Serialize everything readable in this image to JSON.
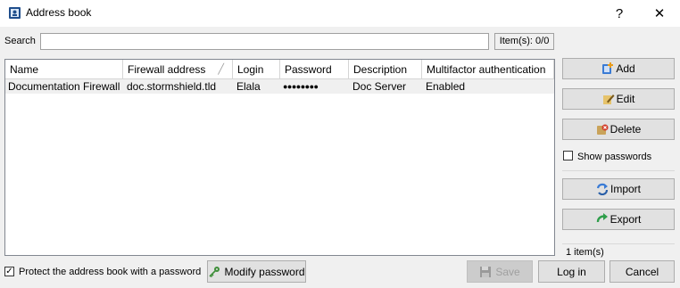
{
  "window": {
    "title": "Address book",
    "help_glyph": "?",
    "close_glyph": "✕"
  },
  "search": {
    "label": "Search",
    "value": "",
    "placeholder": "",
    "item_count": "Item(s): 0/0"
  },
  "table": {
    "columns": [
      "Name",
      "Firewall address",
      "Login",
      "Password",
      "Description",
      "Multifactor authentication"
    ],
    "rows": [
      {
        "name": "Documentation Firewall",
        "firewall_address": "doc.stormshield.tld",
        "login": "Elala",
        "password": "●●●●●●●●",
        "description": "Doc Server",
        "mfa": "Enabled"
      }
    ]
  },
  "side_panel": {
    "add_label": "Add",
    "edit_label": "Edit",
    "delete_label": "Delete",
    "show_passwords_label": "Show passwords",
    "show_passwords_checked": false,
    "import_label": "Import",
    "export_label": "Export",
    "status": "1 item(s)"
  },
  "footer": {
    "protect_label": "Protect the address book with a password",
    "protect_checked": true,
    "check_glyph": "✓",
    "modify_password_label": "Modify password",
    "save_label": "Save",
    "login_label": "Log in",
    "cancel_label": "Cancel"
  },
  "icons": {
    "app": "address-book-icon",
    "add": "add-plus-icon",
    "edit": "edit-pencil-icon",
    "delete": "delete-icon",
    "import": "import-arrow-icon",
    "export": "export-arrow-icon",
    "modify_password": "key-icon",
    "save": "floppy-disk-icon"
  },
  "colors": {
    "window_bg": "#f0f0f0",
    "button_bg": "#e1e1e1",
    "button_border": "#adadad",
    "selected_row": "#f0f0f0",
    "disabled_text": "#a0a0a0"
  }
}
